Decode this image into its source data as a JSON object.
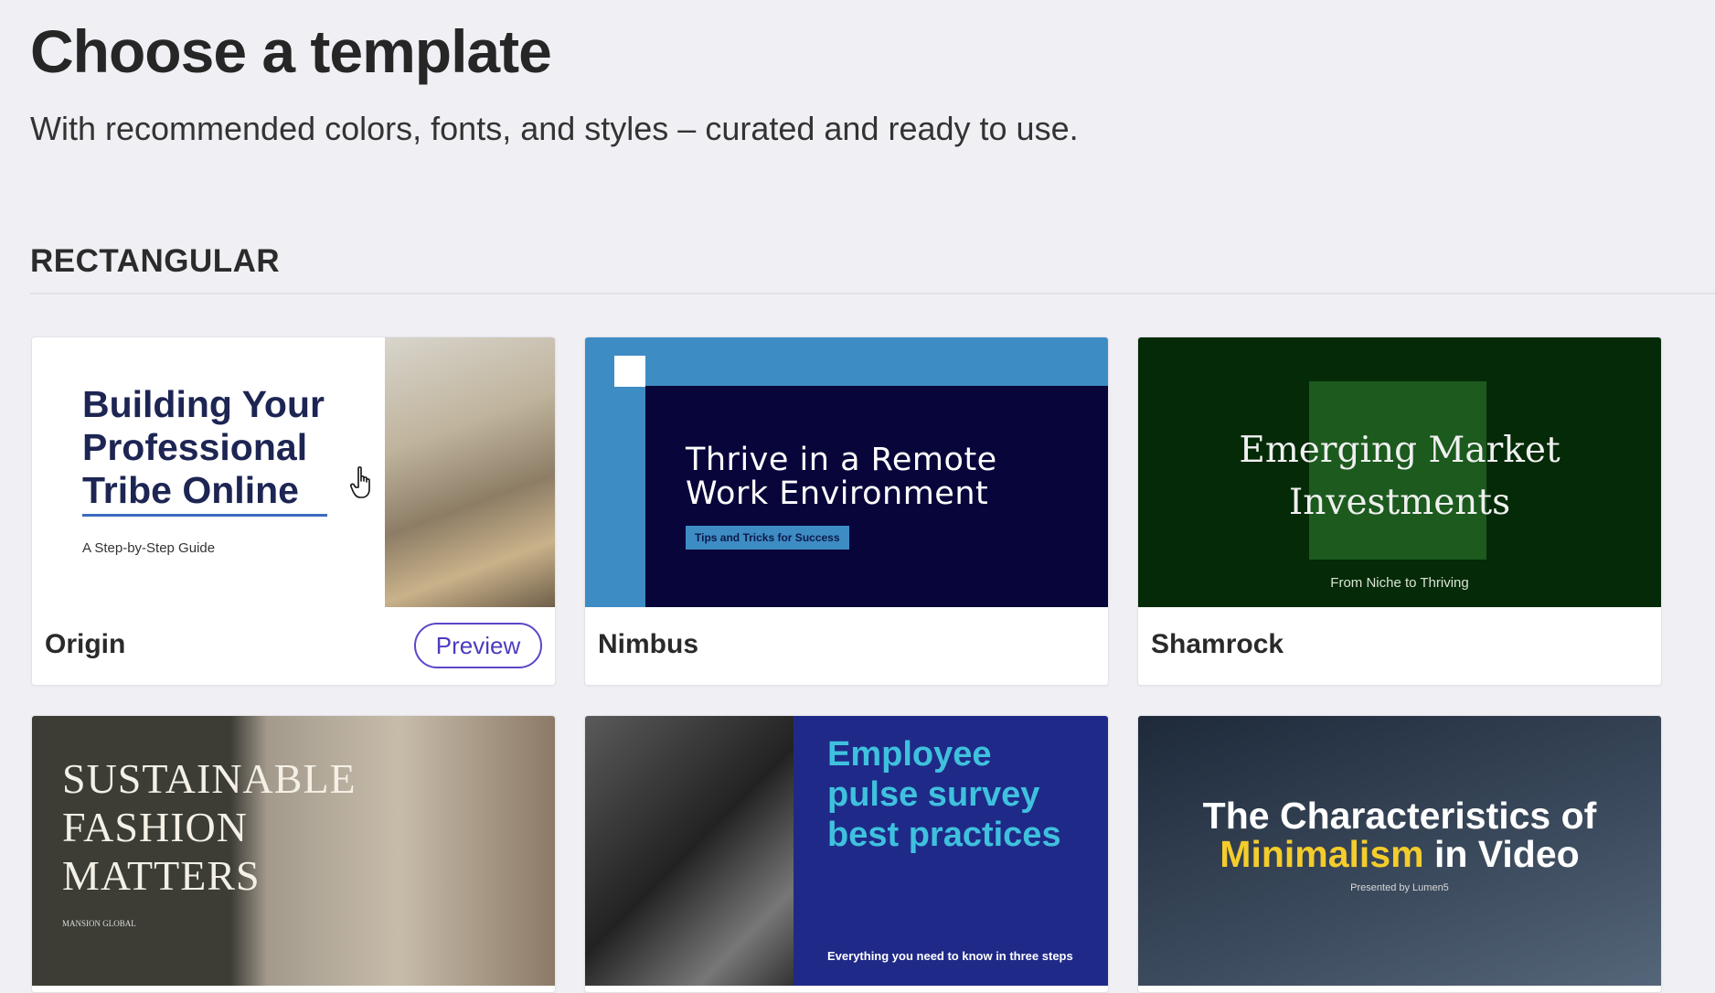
{
  "header": {
    "title": "Choose a template",
    "subtitle": "With recommended colors, fonts, and styles – curated and ready to use."
  },
  "section": {
    "title": "RECTANGULAR"
  },
  "templates": [
    {
      "name": "Origin",
      "preview_label": "Preview",
      "thumb": {
        "title": "Building Your Professional Tribe Online",
        "subtitle": "A Step-by-Step Guide"
      }
    },
    {
      "name": "Nimbus",
      "thumb": {
        "title_line1": "Thrive in a Remote",
        "title_line2": "Work Environment",
        "tag": "Tips and Tricks for Success"
      }
    },
    {
      "name": "Shamrock",
      "thumb": {
        "title_line1": "Emerging Market",
        "title_line2": "Investments",
        "subtitle": "From Niche to Thriving"
      }
    },
    {
      "thumb": {
        "title_line1": "SUSTAINABLE",
        "title_line2": "FASHION",
        "title_line3": "MATTERS",
        "brand": "MANSION GLOBAL"
      }
    },
    {
      "thumb": {
        "title_line1": "Employee",
        "title_line2": "pulse survey",
        "title_line3": "best practices",
        "subtitle": "Everything you need to know in three steps"
      }
    },
    {
      "thumb": {
        "title_part1": "The Characteristics of",
        "title_highlight": "Minimalism",
        "title_part2": " in Video",
        "subtitle": "Presented by Lumen5"
      }
    }
  ],
  "colors": {
    "accent": "#5a48c8",
    "background": "#f0eff4"
  },
  "icons": {
    "cursor": "hand-pointer-icon"
  }
}
